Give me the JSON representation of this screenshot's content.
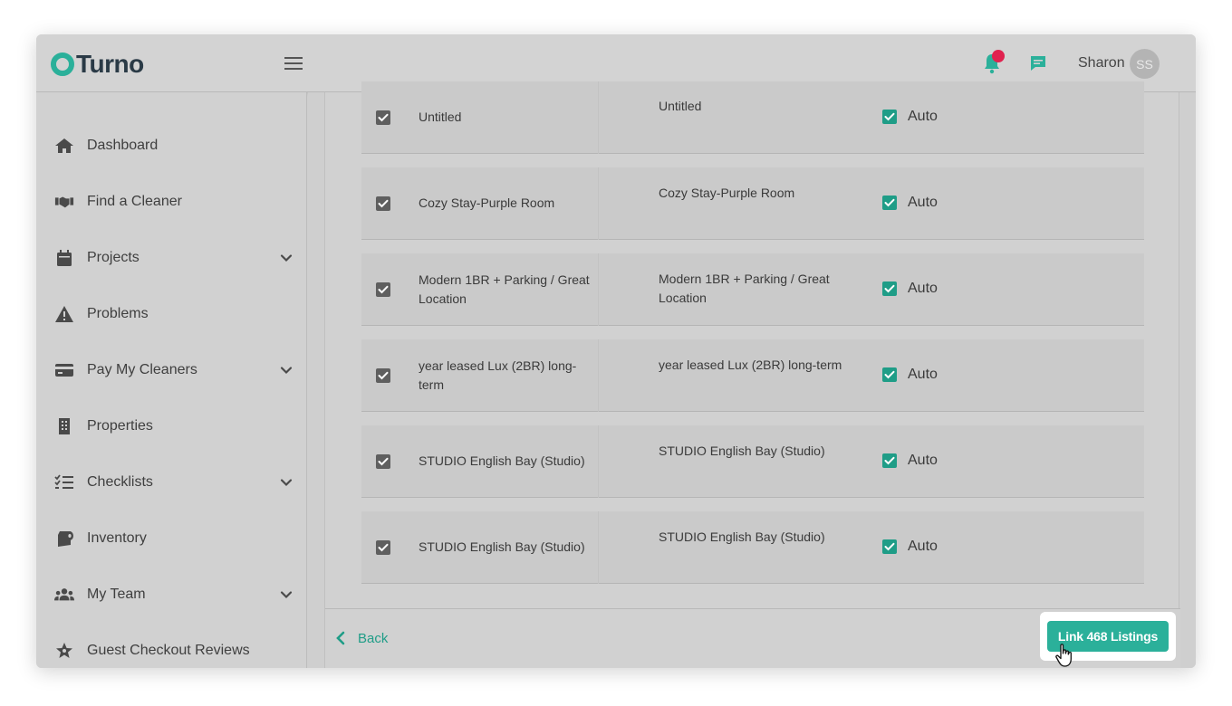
{
  "header": {
    "logo_text": "Turno",
    "user_name": "Sharon",
    "user_initials": "SS",
    "brand_color": "#2bb09a",
    "notification_color": "#e0224f"
  },
  "sidebar": {
    "items": [
      {
        "label": "Dashboard",
        "icon": "home-icon",
        "expandable": false
      },
      {
        "label": "Find a Cleaner",
        "icon": "handshake-icon",
        "expandable": false
      },
      {
        "label": "Projects",
        "icon": "calendar-icon",
        "expandable": true
      },
      {
        "label": "Problems",
        "icon": "warning-icon",
        "expandable": false
      },
      {
        "label": "Pay My Cleaners",
        "icon": "credit-card-icon",
        "expandable": true
      },
      {
        "label": "Properties",
        "icon": "building-icon",
        "expandable": false
      },
      {
        "label": "Checklists",
        "icon": "checklist-icon",
        "expandable": true
      },
      {
        "label": "Inventory",
        "icon": "toilet-paper-icon",
        "expandable": false
      },
      {
        "label": "My Team",
        "icon": "users-icon",
        "expandable": true
      },
      {
        "label": "Guest Checkout Reviews",
        "icon": "star-icon",
        "expandable": false
      }
    ]
  },
  "listings": {
    "rows": [
      {
        "name": "Untitled",
        "match": "Untitled",
        "selected": true,
        "auto": "Auto"
      },
      {
        "name": "Cozy Stay-Purple Room",
        "match": "Cozy Stay-Purple Room",
        "selected": true,
        "auto": "Auto"
      },
      {
        "name": "Modern 1BR + Parking / Great Location",
        "match": "Modern 1BR + Parking / Great Location",
        "selected": true,
        "auto": "Auto"
      },
      {
        "name": "year leased Lux (2BR) long-term",
        "match": "year leased Lux (2BR) long-term",
        "selected": true,
        "auto": "Auto"
      },
      {
        "name": "STUDIO English Bay (Studio)",
        "match": "STUDIO English Bay (Studio)",
        "selected": true,
        "auto": "Auto"
      },
      {
        "name": "STUDIO English Bay (Studio)",
        "match": "STUDIO English Bay (Studio)",
        "selected": true,
        "auto": "Auto"
      }
    ]
  },
  "footer": {
    "back_label": "Back",
    "link_button_label": "Link 468 Listings"
  }
}
